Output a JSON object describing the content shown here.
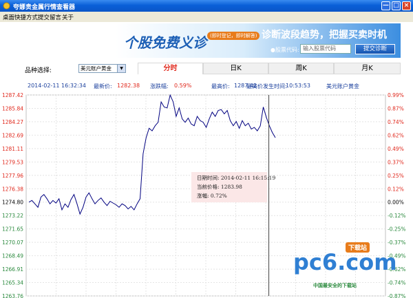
{
  "window": {
    "title": "夸娜贵金属行情查看器",
    "minimize": "0",
    "maximize": "1",
    "close": "r"
  },
  "menu": [
    "桌面快捷方式",
    "提交留言",
    "关于"
  ],
  "banner": {
    "slogan1": "个股免费义诊",
    "pill": "(即时登记，即时解答)",
    "slogan2": "诊断波段趋势，把握买卖时机",
    "code_label": "●股票代码:",
    "code_placeholder": "输入股票代码",
    "diag_button": "提交诊断"
  },
  "selector": {
    "label": "品种选择:",
    "value": "美元账户黄金"
  },
  "tabs": [
    "分时",
    "日K",
    "周K",
    "月K"
  ],
  "info": {
    "datetime": "2014-02-11 16:32:34",
    "latest_label": "最新价:",
    "latest_value": "1282.38",
    "change_label": "涨跌幅:",
    "change_value": "0.59%",
    "high_label": "最高价:",
    "high_value": "1287.42",
    "high_time_label": "最高价发生时间:",
    "high_time_value": "10:53:53",
    "product": "美元账户黄金"
  },
  "tooltip": {
    "date_label": "日期时间:",
    "date_value": "2014-02-11 16:15:19",
    "price_label": "当前价格:",
    "price_value": "1283.98",
    "change_label": "涨幅:",
    "change_value": "0.72%"
  },
  "watermark": {
    "brand": "pc6.com",
    "tag": "下载站",
    "slogan": "中国最安全的下载站"
  },
  "colors": {
    "up": "#e0281c",
    "down": "#2b8a3e",
    "line": "#000080"
  },
  "chart_data": {
    "type": "line",
    "ylim": [
      1263.76,
      1287.42
    ],
    "y_ticks_left": [
      "1287.42",
      "1285.84",
      "1284.27",
      "1282.69",
      "1281.11",
      "1279.53",
      "1277.96",
      "1276.38",
      "1274.80",
      "1273.22",
      "1271.65",
      "1270.07",
      "1268.49",
      "1266.91",
      "1265.34",
      "1263.76"
    ],
    "y_ticks_right": [
      "0.99%",
      "0.87%",
      "0.74%",
      "0.62%",
      "0.49%",
      "0.37%",
      "0.25%",
      "0.12%",
      "0.00%",
      "-0.12%",
      "-0.25%",
      "-0.37%",
      "-0.49%",
      "-0.62%",
      "-0.74%",
      "-0.87%"
    ],
    "series": [
      {
        "values": [
          1274.8,
          1275.0,
          1274.6,
          1274.2,
          1275.4,
          1275.7,
          1275.2,
          1274.6,
          1275.0,
          1274.7,
          1275.2,
          1273.9,
          1274.6,
          1274.2,
          1275.1,
          1275.7,
          1274.6,
          1273.4,
          1274.2,
          1275.4,
          1275.9,
          1275.2,
          1274.6,
          1275.0,
          1275.3,
          1274.8,
          1274.4,
          1274.9,
          1274.7,
          1274.5,
          1274.2,
          1274.6,
          1274.4,
          1274.0,
          1274.3,
          1273.9,
          1274.6,
          1275.2,
          1280.5,
          1282.4,
          1283.5,
          1283.2,
          1283.8,
          1284.2,
          1286.6,
          1286.0,
          1285.9,
          1287.4,
          1286.6,
          1284.9,
          1285.9,
          1284.6,
          1284.2,
          1284.7,
          1284.0,
          1283.8,
          1284.9,
          1284.4,
          1284.2,
          1283.6,
          1284.6,
          1285.4,
          1284.9,
          1285.6,
          1285.7,
          1285.2,
          1285.6,
          1284.4,
          1283.8,
          1284.3,
          1283.5,
          1284.4,
          1283.8,
          1284.1,
          1283.4,
          1283.6,
          1283.2,
          1283.8,
          1286.0,
          1284.8,
          1283.8,
          1283.0,
          1282.4
        ]
      }
    ]
  }
}
